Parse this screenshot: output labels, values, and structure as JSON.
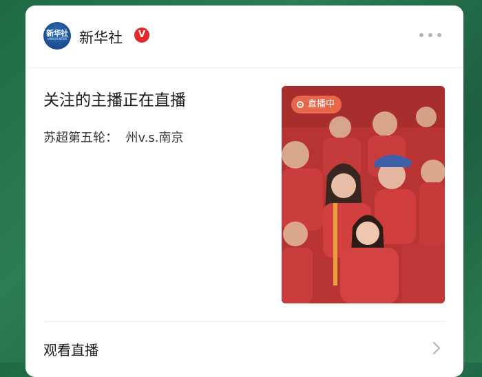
{
  "account": {
    "name": "新华社",
    "verified_mark": "V",
    "avatar_text": "新华社",
    "avatar_subtext": "XINHUA NEWS"
  },
  "post": {
    "headline": "关注的主播正在直播",
    "subline": "苏超第五轮：  州v.s.南京"
  },
  "live": {
    "badge_label": "直播中"
  },
  "footer": {
    "watch_label": "观看直播"
  },
  "icons": {
    "more": "more-dots-icon",
    "chevron": "chevron-right-icon",
    "live": "live-dot-icon",
    "verified": "verified-badge-icon"
  },
  "colors": {
    "background": "#2b7d55",
    "card": "#ffffff",
    "verified": "#e02a2a",
    "live_badge": "#e8674a",
    "jersey": "#c53a3a"
  }
}
